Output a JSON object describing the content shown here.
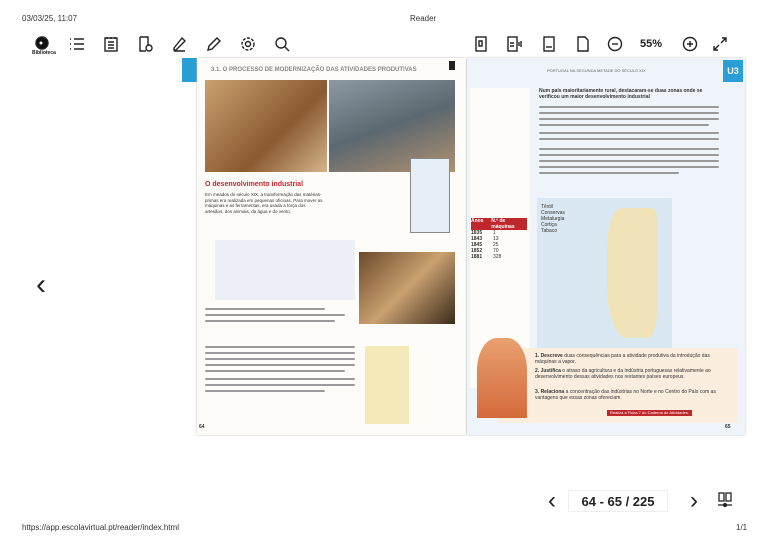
{
  "print_header": {
    "datetime": "03/03/25, 11:07",
    "title": "Reader"
  },
  "toolbar": {
    "library_label": "Biblioteca",
    "left_icons": [
      "library-icon",
      "list-icon",
      "notes-icon",
      "resources-icon",
      "highlighter-icon",
      "pencil-icon",
      "settings-icon",
      "search-icon"
    ],
    "right_icons": [
      "digital-book-icon",
      "audio-book-icon",
      "fit-width-icon",
      "single-page-icon",
      "zoom-out-icon",
      "zoom-in-icon",
      "fullscreen-icon"
    ],
    "zoom_level": "55%"
  },
  "book": {
    "left_header": "3.1. O PROCESSO DE MODERNIZAÇÃO DAS ATIVIDADES PRODUTIVAS",
    "right_header": "PORTUGAL NA SEGUNDA METADE DO SÉCULO XIX",
    "unit_badge": "U3",
    "section_title": "O desenvolvimento industrial",
    "section_intro": "Em meados do século XIX, a transformação das matérias-primas era realizada em pequenas oficinas. Para mover as máquinas e as ferramentas, era usada a força dos artesãos, dos animais, da água e do vento.",
    "right_intro": "Num país maioritariamente rural, destacaram-se duas zonas onde se verificou um maior desenvolvimento industrial",
    "table_headers": [
      "Anos",
      "N.º de máquinas"
    ],
    "table_rows": [
      [
        "1835",
        "1"
      ],
      [
        "1843",
        "13"
      ],
      [
        "1845",
        "25"
      ],
      [
        "1852",
        "70"
      ],
      [
        "1881",
        "328"
      ]
    ],
    "legend": [
      "Têxtil",
      "Conservas",
      "Metalurgia",
      "Cortiça",
      "Tabaco"
    ],
    "tasks": [
      {
        "num": "1.",
        "verb": "Descreve",
        "text": "duas consequências para a atividade produtiva da introdução das máquinas a vapor."
      },
      {
        "num": "2.",
        "verb": "Justifica",
        "text": "o atraso da agricultura e da indústria portuguesas relativamente ao desenvolvimento dessas atividades nos restantes países europeus."
      },
      {
        "num": "3.",
        "verb": "Relaciona",
        "text": "a concentração das indústrias no Norte e no Centro do País com as vantagens que essas zonas ofereciam."
      }
    ],
    "task_ref": "Realiza a Ficha 7 do Caderno de Atividades.",
    "left_page_number": "64",
    "right_page_number": "65"
  },
  "pagination": {
    "indicator": "64 - 65 / 225"
  },
  "print_footer": {
    "url": "https://app.escolavirtual.pt/reader/index.html",
    "page": "1/1"
  },
  "colors": {
    "accent_blue": "#2a9fd6",
    "heading_red": "#c0272d"
  }
}
